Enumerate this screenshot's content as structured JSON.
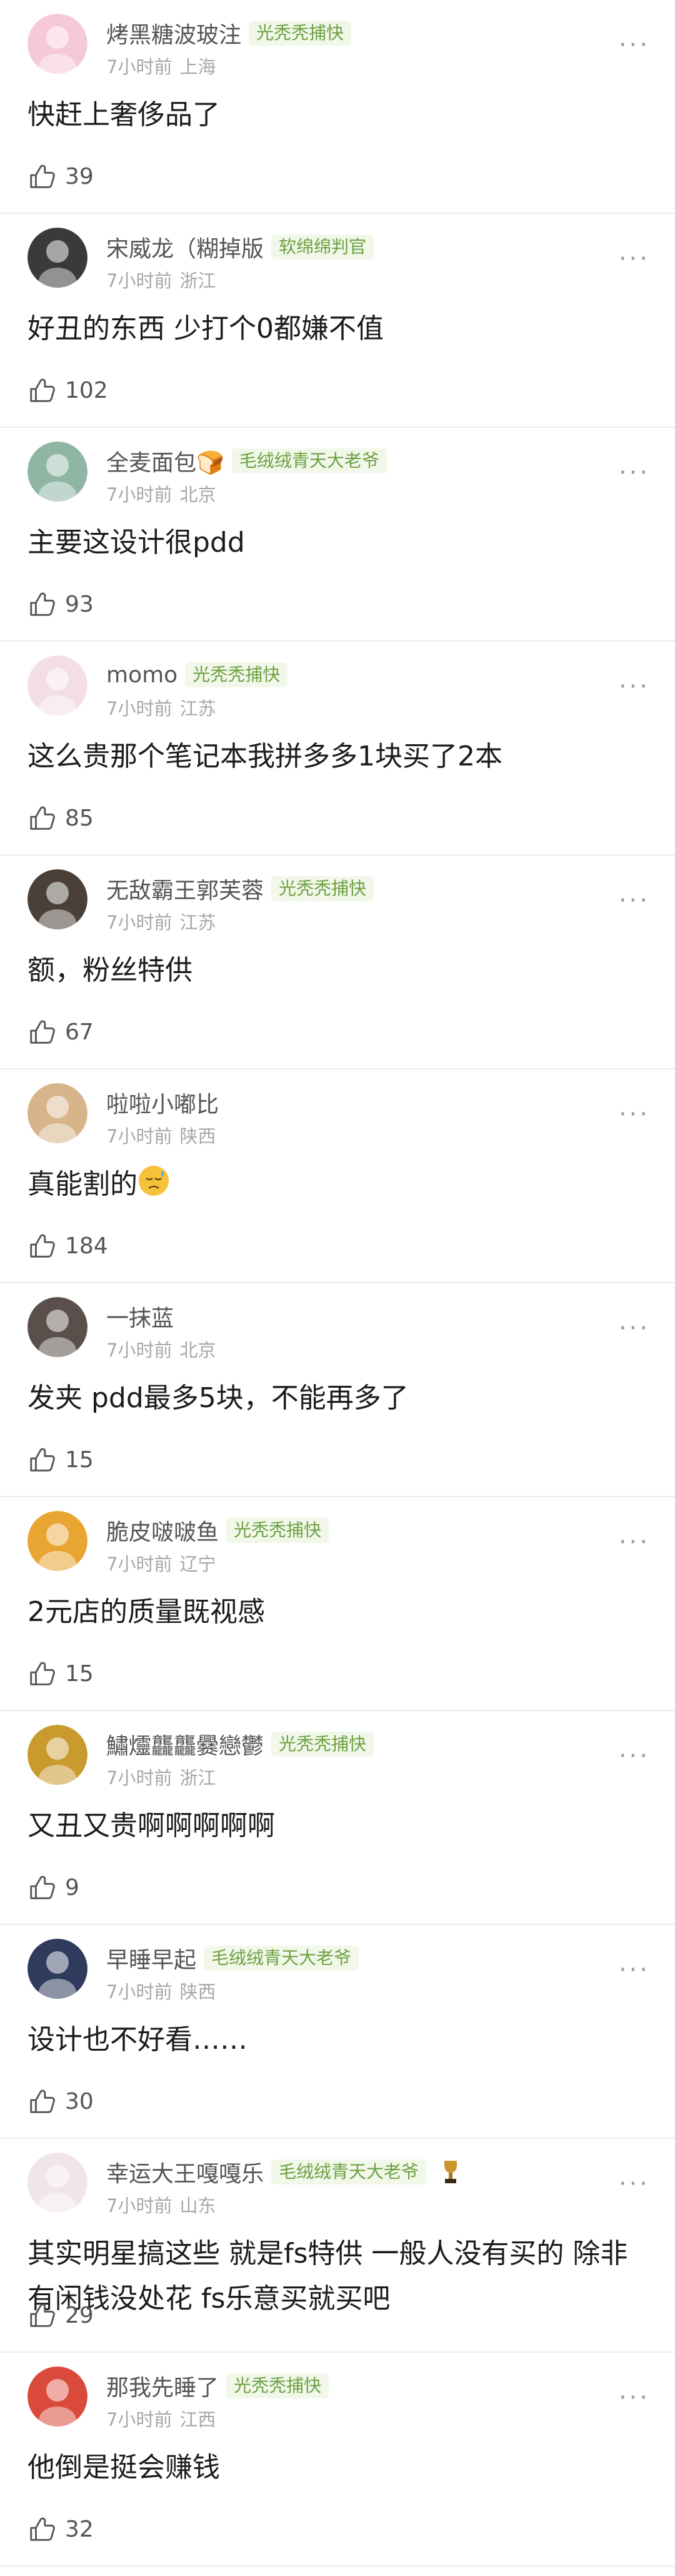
{
  "comments": [
    {
      "name": "烤黑糖波玻注",
      "badge": "光秃秃捕快",
      "time": "7小时前",
      "location": "上海",
      "text": "快赶上奢侈品了",
      "likes": "39",
      "avatar_color": "#f6c9d6"
    },
    {
      "name": "宋威龙（糊掉版",
      "badge": "软绵绵判官",
      "time": "7小时前",
      "location": "浙江",
      "text": "好丑的东西 少打个0都嫌不值",
      "likes": "102",
      "avatar_color": "#3a3a3a"
    },
    {
      "name": "全麦面包🍞",
      "badge": "毛绒绒青天大老爷",
      "time": "7小时前",
      "location": "北京",
      "text": "主要这设计很pdd",
      "likes": "93",
      "avatar_color": "#8fb5a5"
    },
    {
      "name": "momo",
      "badge": "光秃秃捕快",
      "time": "7小时前",
      "location": "江苏",
      "text": "这么贵那个笔记本我拼多多1块买了2本",
      "likes": "85",
      "avatar_color": "#f3dfe3"
    },
    {
      "name": "无敌霸王郭芙蓉",
      "badge": "光秃秃捕快",
      "time": "7小时前",
      "location": "江苏",
      "text": "额，粉丝特供",
      "likes": "67",
      "avatar_color": "#4a4038"
    },
    {
      "name": "啦啦小嘟比",
      "badge": "",
      "time": "7小时前",
      "location": "陕西",
      "text": "真能割的",
      "likes": "184",
      "avatar_color": "#d8b48a",
      "emoji": "downcast-face"
    },
    {
      "name": "一抹蓝",
      "badge": "",
      "time": "7小时前",
      "location": "北京",
      "text": "发夹 pdd最多5块，不能再多了",
      "likes": "15",
      "avatar_color": "#5a4f4a"
    },
    {
      "name": "脆皮啵啵鱼",
      "badge": "光秃秃捕快",
      "time": "7小时前",
      "location": "辽宁",
      "text": "2元店的质量既视感",
      "likes": "15",
      "avatar_color": "#e8a531"
    },
    {
      "name": "鱐爧龘龘爨戀鬱",
      "badge": "光秃秃捕快",
      "time": "7小时前",
      "location": "浙江",
      "text": "又丑又贵啊啊啊啊啊",
      "likes": "9",
      "avatar_color": "#c99a2e"
    },
    {
      "name": "早睡早起",
      "badge": "毛绒绒青天大老爷",
      "time": "7小时前",
      "location": "陕西",
      "text": "设计也不好看……",
      "likes": "30",
      "avatar_color": "#2f3b5c"
    },
    {
      "name": "幸运大王嘎嘎乐",
      "badge": "毛绒绒青天大老爷",
      "time": "7小时前",
      "location": "山东",
      "text": "其实明星搞这些  就是fs特供  一般人没有买的 除非有闲钱没处花  fs乐意买就买吧",
      "likes": "29",
      "avatar_color": "#f0e6ea",
      "trophy": true
    },
    {
      "name": "那我先睡了",
      "badge": "光秃秃捕快",
      "time": "7小时前",
      "location": "江西",
      "text": "他倒是挺会赚钱",
      "likes": "32",
      "avatar_color": "#d94a3a"
    }
  ],
  "more_label": "···"
}
